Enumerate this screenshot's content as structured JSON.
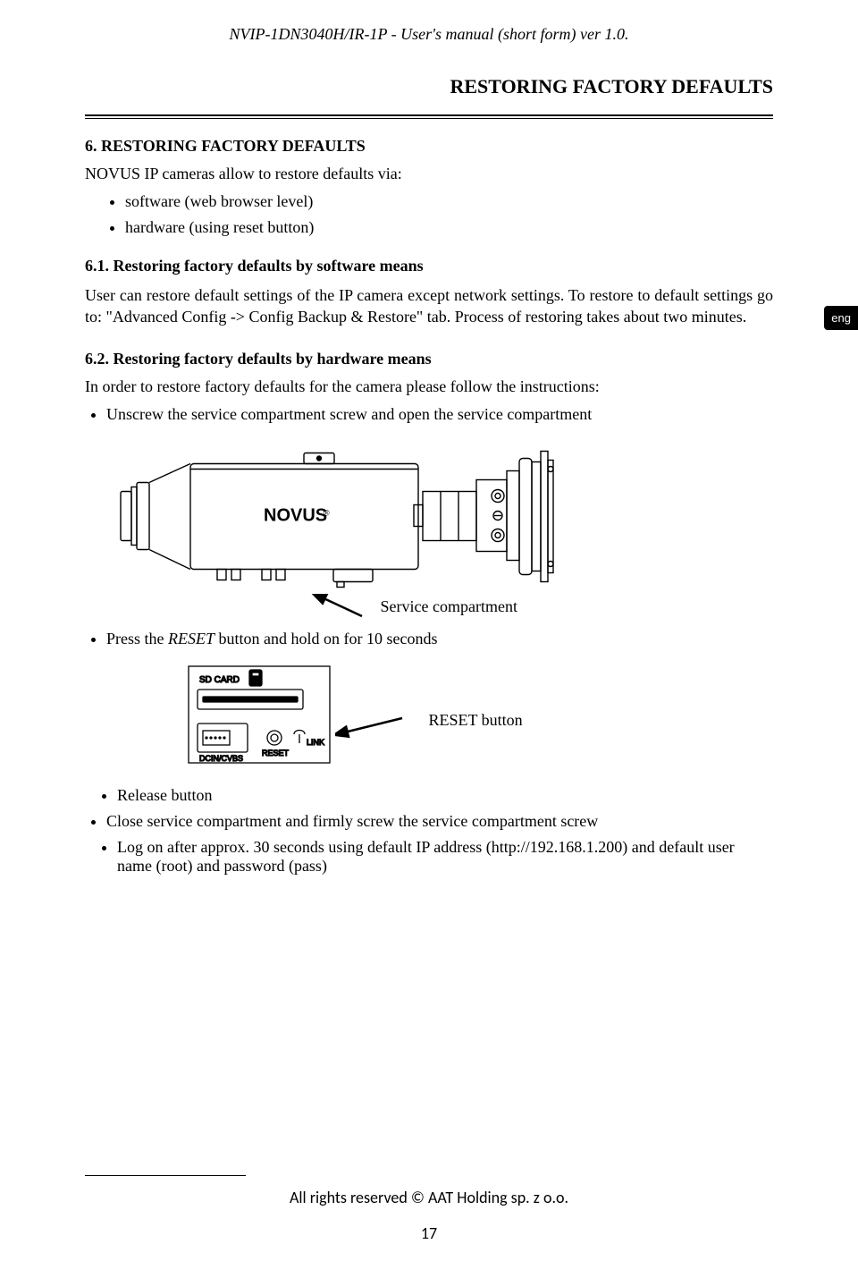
{
  "header": "NVIP-1DN3040H/IR-1P - User's manual (short form) ver 1.0.",
  "page_heading": "RESTORING FACTORY DEFAULTS",
  "lang_tab": "eng",
  "section6": {
    "title": "6. RESTORING FACTORY DEFAULTS",
    "intro": "NOVUS IP cameras allow to restore defaults via:",
    "bullets": [
      "software (web browser level)",
      "hardware (using reset button)"
    ]
  },
  "section61": {
    "title": "6.1. Restoring factory defaults by software means",
    "body": "User can restore default settings of the IP camera except network settings. To restore to default settings go to: \"Advanced Config -> Config Backup & Restore\" tab. Process of restoring takes about two minutes."
  },
  "section62": {
    "title": "6.2. Restoring factory defaults by hardware means",
    "intro": "In order to restore factory defaults for the camera please follow the instructions:",
    "step1": "Unscrew the service compartment screw and open the service compartment",
    "diagram_brand": "NOVUS",
    "diagram_callout": "Service compartment",
    "step2_prefix": "Press the ",
    "step2_italic": "RESET",
    "step2_suffix": "  button and hold on for 10 seconds",
    "reset_labels": {
      "sd": "SD CARD",
      "dcin": "DCIN/CVBS",
      "reset": "RESET",
      "link": "LINK"
    },
    "reset_callout": "RESET button",
    "step3": "Release button",
    "step4": "Close service compartment and firmly screw the service compartment screw",
    "step5": "Log on after approx. 30 seconds using default IP address (http://192.168.1.200) and default user name (root) and password (pass)"
  },
  "footer": "All rights reserved © AAT Holding sp. z o.o.",
  "page_number": "17"
}
